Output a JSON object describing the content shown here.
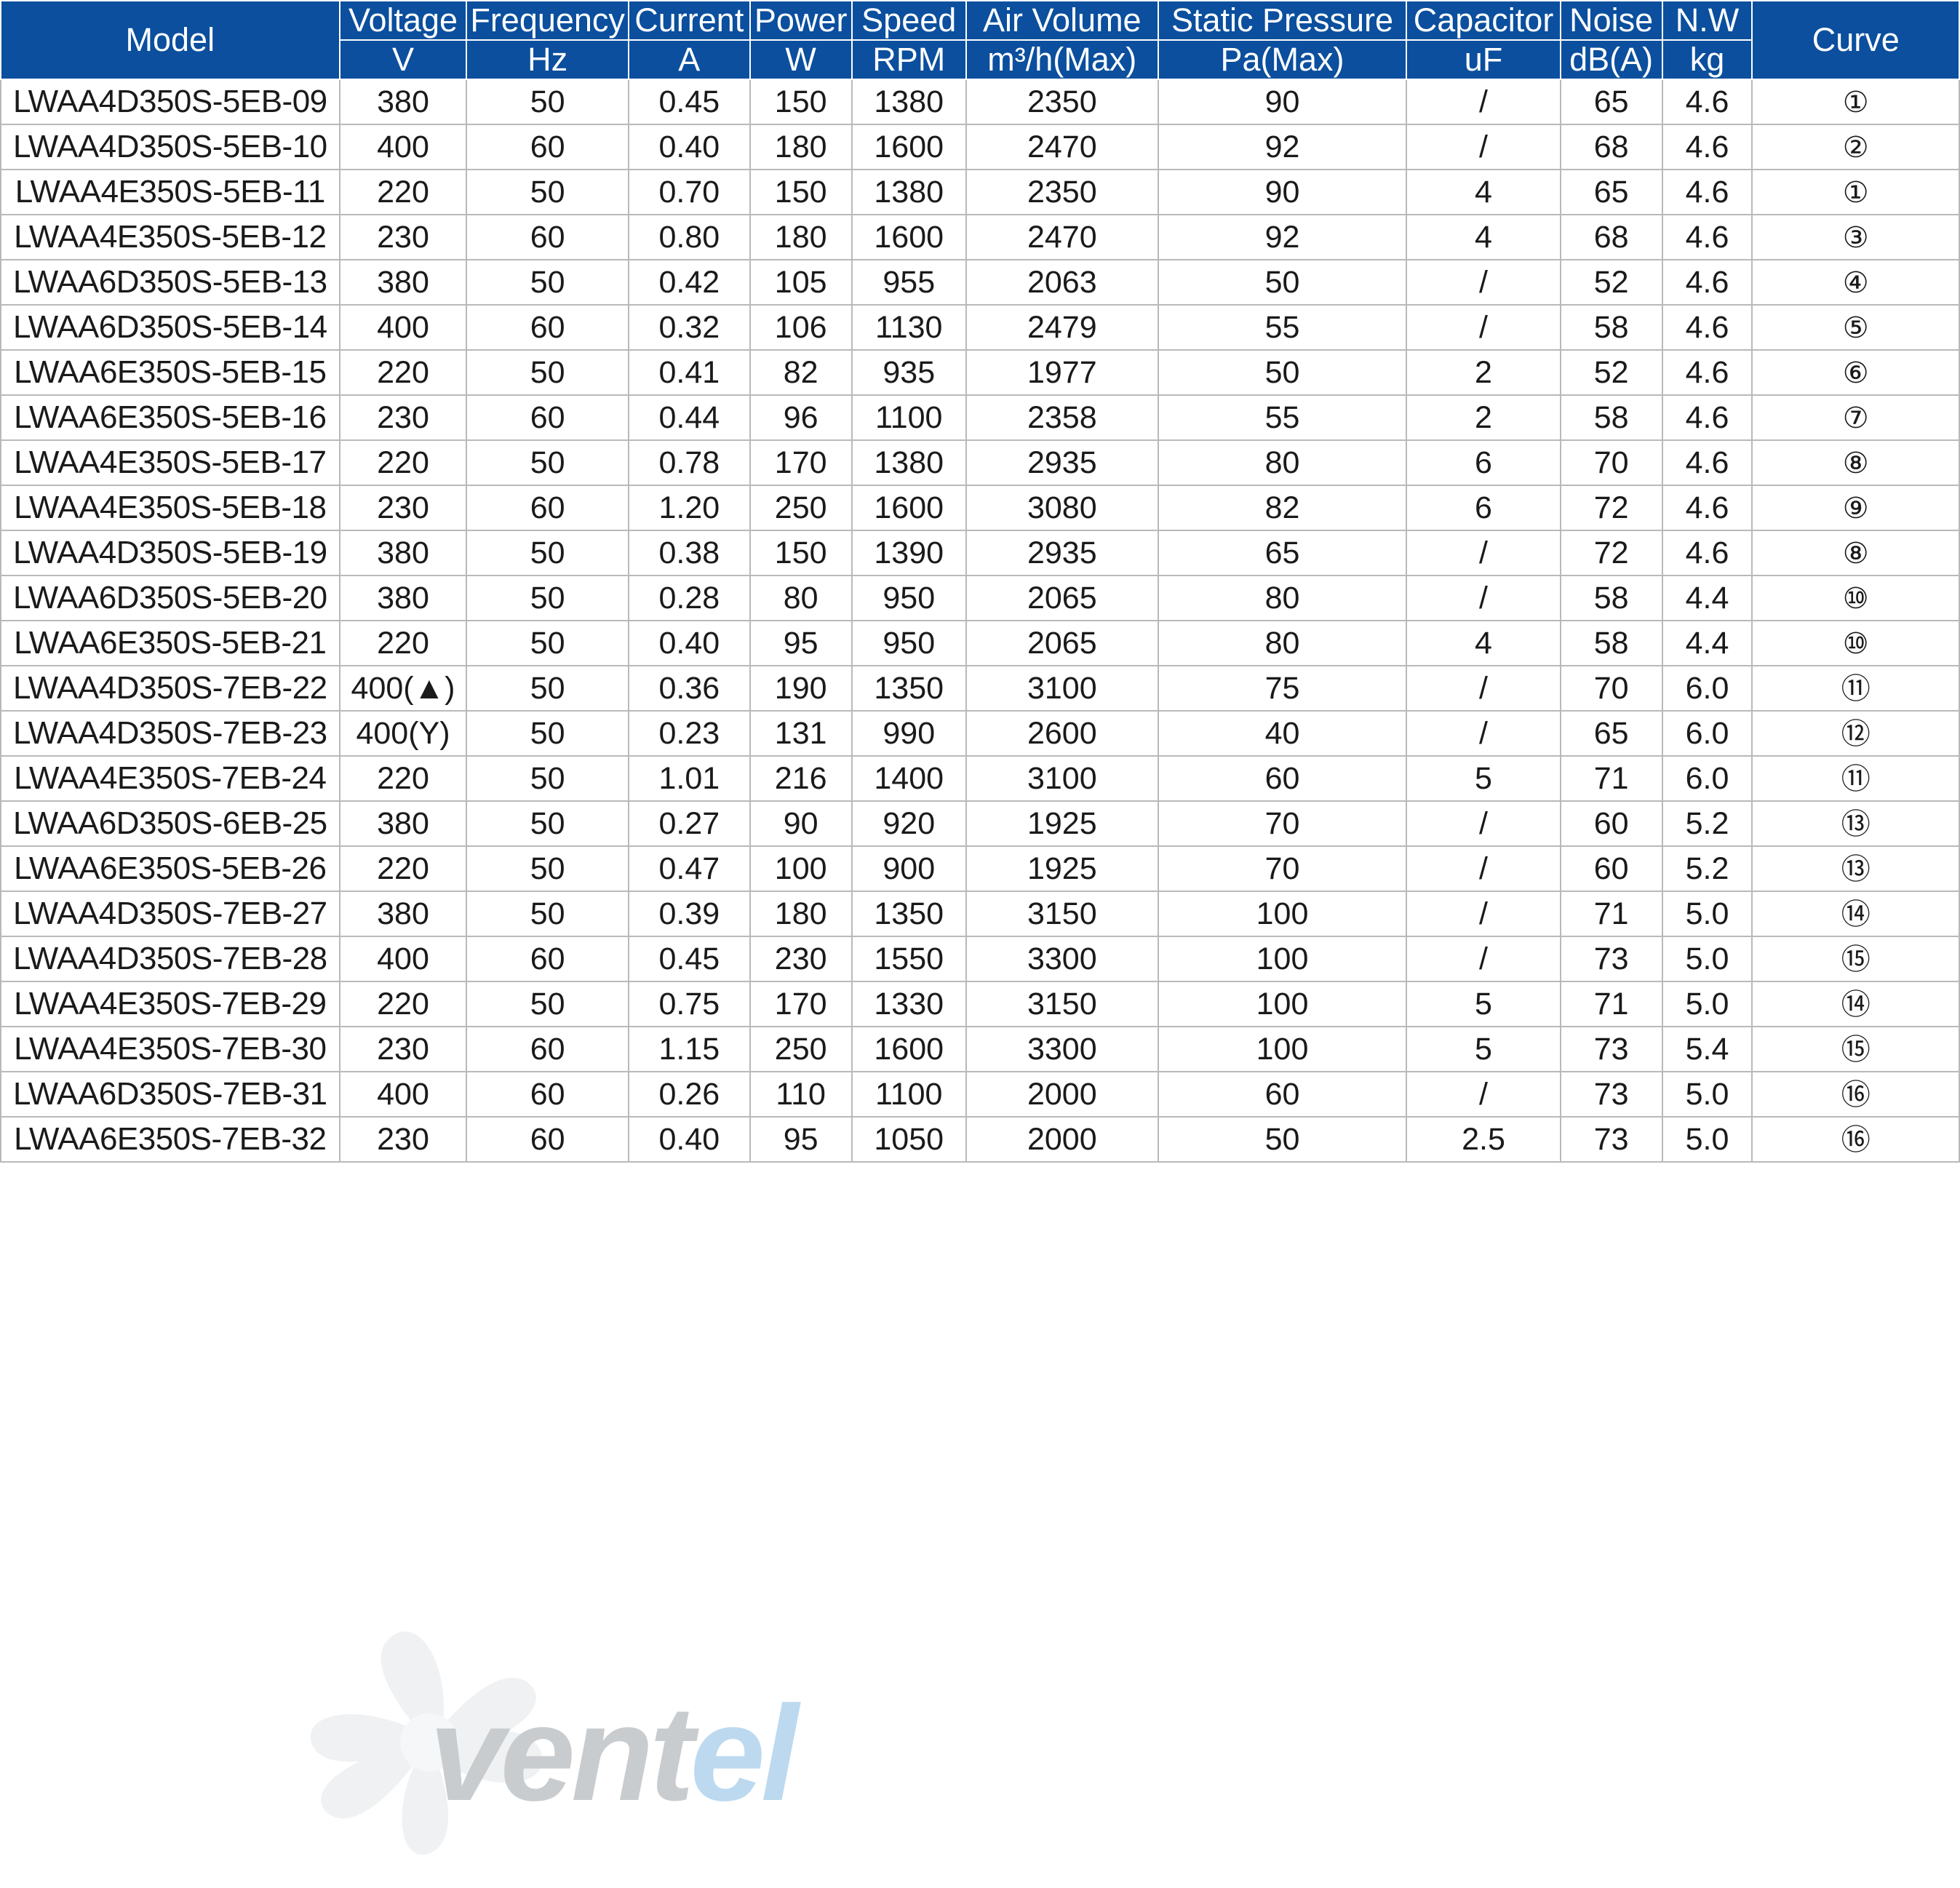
{
  "watermark": {
    "text_primary": "vent",
    "text_secondary": "el",
    "icon": "fan-impeller-icon"
  },
  "table": {
    "columns": [
      {
        "key": "model",
        "group": "Model",
        "unit": ""
      },
      {
        "key": "voltage",
        "group": "Voltage",
        "unit": "V"
      },
      {
        "key": "frequency",
        "group": "Frequency",
        "unit": "Hz"
      },
      {
        "key": "current",
        "group": "Current",
        "unit": "A"
      },
      {
        "key": "power",
        "group": "Power",
        "unit": "W"
      },
      {
        "key": "speed",
        "group": "Speed",
        "unit": "RPM"
      },
      {
        "key": "air",
        "group": "Air Volume",
        "unit": "m³/h(Max)"
      },
      {
        "key": "static",
        "group": "Static Pressure",
        "unit": "Pa(Max)"
      },
      {
        "key": "capacitor",
        "group": "Capacitor",
        "unit": "uF"
      },
      {
        "key": "noise",
        "group": "Noise",
        "unit": "dB(A)"
      },
      {
        "key": "nw",
        "group": "N.W",
        "unit": "kg"
      },
      {
        "key": "curve",
        "group": "Curve",
        "unit": ""
      }
    ],
    "rows": [
      {
        "model": "LWAA4D350S-5EB-09",
        "voltage": "380",
        "frequency": "50",
        "current": "0.45",
        "power": "150",
        "speed": "1380",
        "air": "2350",
        "static": "90",
        "capacitor": "/",
        "noise": "65",
        "nw": "4.6",
        "curve": "①"
      },
      {
        "model": "LWAA4D350S-5EB-10",
        "voltage": "400",
        "frequency": "60",
        "current": "0.40",
        "power": "180",
        "speed": "1600",
        "air": "2470",
        "static": "92",
        "capacitor": "/",
        "noise": "68",
        "nw": "4.6",
        "curve": "②"
      },
      {
        "model": "LWAA4E350S-5EB-11",
        "voltage": "220",
        "frequency": "50",
        "current": "0.70",
        "power": "150",
        "speed": "1380",
        "air": "2350",
        "static": "90",
        "capacitor": "4",
        "noise": "65",
        "nw": "4.6",
        "curve": "①"
      },
      {
        "model": "LWAA4E350S-5EB-12",
        "voltage": "230",
        "frequency": "60",
        "current": "0.80",
        "power": "180",
        "speed": "1600",
        "air": "2470",
        "static": "92",
        "capacitor": "4",
        "noise": "68",
        "nw": "4.6",
        "curve": "③"
      },
      {
        "model": "LWAA6D350S-5EB-13",
        "voltage": "380",
        "frequency": "50",
        "current": "0.42",
        "power": "105",
        "speed": "955",
        "air": "2063",
        "static": "50",
        "capacitor": "/",
        "noise": "52",
        "nw": "4.6",
        "curve": "④"
      },
      {
        "model": "LWAA6D350S-5EB-14",
        "voltage": "400",
        "frequency": "60",
        "current": "0.32",
        "power": "106",
        "speed": "1130",
        "air": "2479",
        "static": "55",
        "capacitor": "/",
        "noise": "58",
        "nw": "4.6",
        "curve": "⑤"
      },
      {
        "model": "LWAA6E350S-5EB-15",
        "voltage": "220",
        "frequency": "50",
        "current": "0.41",
        "power": "82",
        "speed": "935",
        "air": "1977",
        "static": "50",
        "capacitor": "2",
        "noise": "52",
        "nw": "4.6",
        "curve": "⑥"
      },
      {
        "model": "LWAA6E350S-5EB-16",
        "voltage": "230",
        "frequency": "60",
        "current": "0.44",
        "power": "96",
        "speed": "1100",
        "air": "2358",
        "static": "55",
        "capacitor": "2",
        "noise": "58",
        "nw": "4.6",
        "curve": "⑦"
      },
      {
        "model": "LWAA4E350S-5EB-17",
        "voltage": "220",
        "frequency": "50",
        "current": "0.78",
        "power": "170",
        "speed": "1380",
        "air": "2935",
        "static": "80",
        "capacitor": "6",
        "noise": "70",
        "nw": "4.6",
        "curve": "⑧"
      },
      {
        "model": "LWAA4E350S-5EB-18",
        "voltage": "230",
        "frequency": "60",
        "current": "1.20",
        "power": "250",
        "speed": "1600",
        "air": "3080",
        "static": "82",
        "capacitor": "6",
        "noise": "72",
        "nw": "4.6",
        "curve": "⑨"
      },
      {
        "model": "LWAA4D350S-5EB-19",
        "voltage": "380",
        "frequency": "50",
        "current": "0.38",
        "power": "150",
        "speed": "1390",
        "air": "2935",
        "static": "65",
        "capacitor": "/",
        "noise": "72",
        "nw": "4.6",
        "curve": "⑧"
      },
      {
        "model": "LWAA6D350S-5EB-20",
        "voltage": "380",
        "frequency": "50",
        "current": "0.28",
        "power": "80",
        "speed": "950",
        "air": "2065",
        "static": "80",
        "capacitor": "/",
        "noise": "58",
        "nw": "4.4",
        "curve": "⑩"
      },
      {
        "model": "LWAA6E350S-5EB-21",
        "voltage": "220",
        "frequency": "50",
        "current": "0.40",
        "power": "95",
        "speed": "950",
        "air": "2065",
        "static": "80",
        "capacitor": "4",
        "noise": "58",
        "nw": "4.4",
        "curve": "⑩"
      },
      {
        "model": "LWAA4D350S-7EB-22",
        "voltage": "400(▲)",
        "frequency": "50",
        "current": "0.36",
        "power": "190",
        "speed": "1350",
        "air": "3100",
        "static": "75",
        "capacitor": "/",
        "noise": "70",
        "nw": "6.0",
        "curve": "⑪"
      },
      {
        "model": "LWAA4D350S-7EB-23",
        "voltage": "400(Y)",
        "frequency": "50",
        "current": "0.23",
        "power": "131",
        "speed": "990",
        "air": "2600",
        "static": "40",
        "capacitor": "/",
        "noise": "65",
        "nw": "6.0",
        "curve": "⑫"
      },
      {
        "model": "LWAA4E350S-7EB-24",
        "voltage": "220",
        "frequency": "50",
        "current": "1.01",
        "power": "216",
        "speed": "1400",
        "air": "3100",
        "static": "60",
        "capacitor": "5",
        "noise": "71",
        "nw": "6.0",
        "curve": "⑪"
      },
      {
        "model": "LWAA6D350S-6EB-25",
        "voltage": "380",
        "frequency": "50",
        "current": "0.27",
        "power": "90",
        "speed": "920",
        "air": "1925",
        "static": "70",
        "capacitor": "/",
        "noise": "60",
        "nw": "5.2",
        "curve": "⑬"
      },
      {
        "model": "LWAA6E350S-5EB-26",
        "voltage": "220",
        "frequency": "50",
        "current": "0.47",
        "power": "100",
        "speed": "900",
        "air": "1925",
        "static": "70",
        "capacitor": "/",
        "noise": "60",
        "nw": "5.2",
        "curve": "⑬"
      },
      {
        "model": "LWAA4D350S-7EB-27",
        "voltage": "380",
        "frequency": "50",
        "current": "0.39",
        "power": "180",
        "speed": "1350",
        "air": "3150",
        "static": "100",
        "capacitor": "/",
        "noise": "71",
        "nw": "5.0",
        "curve": "⑭"
      },
      {
        "model": "LWAA4D350S-7EB-28",
        "voltage": "400",
        "frequency": "60",
        "current": "0.45",
        "power": "230",
        "speed": "1550",
        "air": "3300",
        "static": "100",
        "capacitor": "/",
        "noise": "73",
        "nw": "5.0",
        "curve": "⑮"
      },
      {
        "model": "LWAA4E350S-7EB-29",
        "voltage": "220",
        "frequency": "50",
        "current": "0.75",
        "power": "170",
        "speed": "1330",
        "air": "3150",
        "static": "100",
        "capacitor": "5",
        "noise": "71",
        "nw": "5.0",
        "curve": "⑭"
      },
      {
        "model": "LWAA4E350S-7EB-30",
        "voltage": "230",
        "frequency": "60",
        "current": "1.15",
        "power": "250",
        "speed": "1600",
        "air": "3300",
        "static": "100",
        "capacitor": "5",
        "noise": "73",
        "nw": "5.4",
        "curve": "⑮"
      },
      {
        "model": "LWAA6D350S-7EB-31",
        "voltage": "400",
        "frequency": "60",
        "current": "0.26",
        "power": "110",
        "speed": "1100",
        "air": "2000",
        "static": "60",
        "capacitor": "/",
        "noise": "73",
        "nw": "5.0",
        "curve": "⑯"
      },
      {
        "model": "LWAA6E350S-7EB-32",
        "voltage": "230",
        "frequency": "60",
        "current": "0.40",
        "power": "95",
        "speed": "1050",
        "air": "2000",
        "static": "50",
        "capacitor": "2.5",
        "noise": "73",
        "nw": "5.0",
        "curve": "⑯"
      }
    ]
  },
  "colors": {
    "header_blue": "#0b4f9e",
    "grid": "#b9b9b9",
    "text": "#1a1a1a"
  }
}
